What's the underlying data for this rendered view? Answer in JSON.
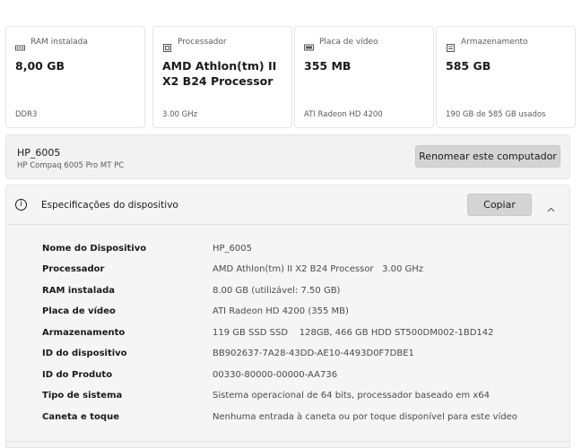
{
  "cards": [
    {
      "icon": "ram-icon",
      "label": "RAM instalada",
      "value": "8,00 GB",
      "sub": "DDR3"
    },
    {
      "icon": "processor-icon",
      "label": "Processador",
      "value": "AMD Athlon(tm) II X2 B24 Processor",
      "sub": "3.00 GHz"
    },
    {
      "icon": "display-icon",
      "label": "Placa de vídeo",
      "value": "355 MB",
      "sub": "ATI Radeon HD 4200"
    },
    {
      "icon": "storage-icon",
      "label": "Armazenamento",
      "value": "585 GB",
      "sub": "190 GB de 585 GB usados"
    }
  ],
  "computer": {
    "name": "HP_6005",
    "model": "HP Compaq 6005 Pro MT PC",
    "rename_label": "Renomear este computador"
  },
  "specs": {
    "title": "Especificações do dispositivo",
    "copy_label": "Copiar",
    "rows": [
      {
        "key": "Nome do Dispositivo",
        "value": "HP_6005"
      },
      {
        "key": "Processador",
        "value": "AMD Athlon(tm) II X2 B24 Processor   3.00 GHz"
      },
      {
        "key": "RAM instalada",
        "value": "8.00 GB (utilizável: 7.50 GB)"
      },
      {
        "key": "Placa de vídeo",
        "value": "ATI Radeon HD 4200 (355 MB)"
      },
      {
        "key": "Armazenamento",
        "value": "119 GB SSD SSD    128GB, 466 GB HDD ST500DM002-1BD142"
      },
      {
        "key": "ID do dispositivo",
        "value": "BB902637-7A28-43DD-AE10-4493D0F7DBE1"
      },
      {
        "key": "ID do Produto",
        "value": "00330-80000-00000-AA736"
      },
      {
        "key": "Tipo de sistema",
        "value": "Sistema operacional de 64 bits, processador baseado em x64"
      },
      {
        "key": "Caneta e toque",
        "value": "Nenhuma entrada à caneta ou por toque disponível para este vídeo"
      }
    ]
  }
}
